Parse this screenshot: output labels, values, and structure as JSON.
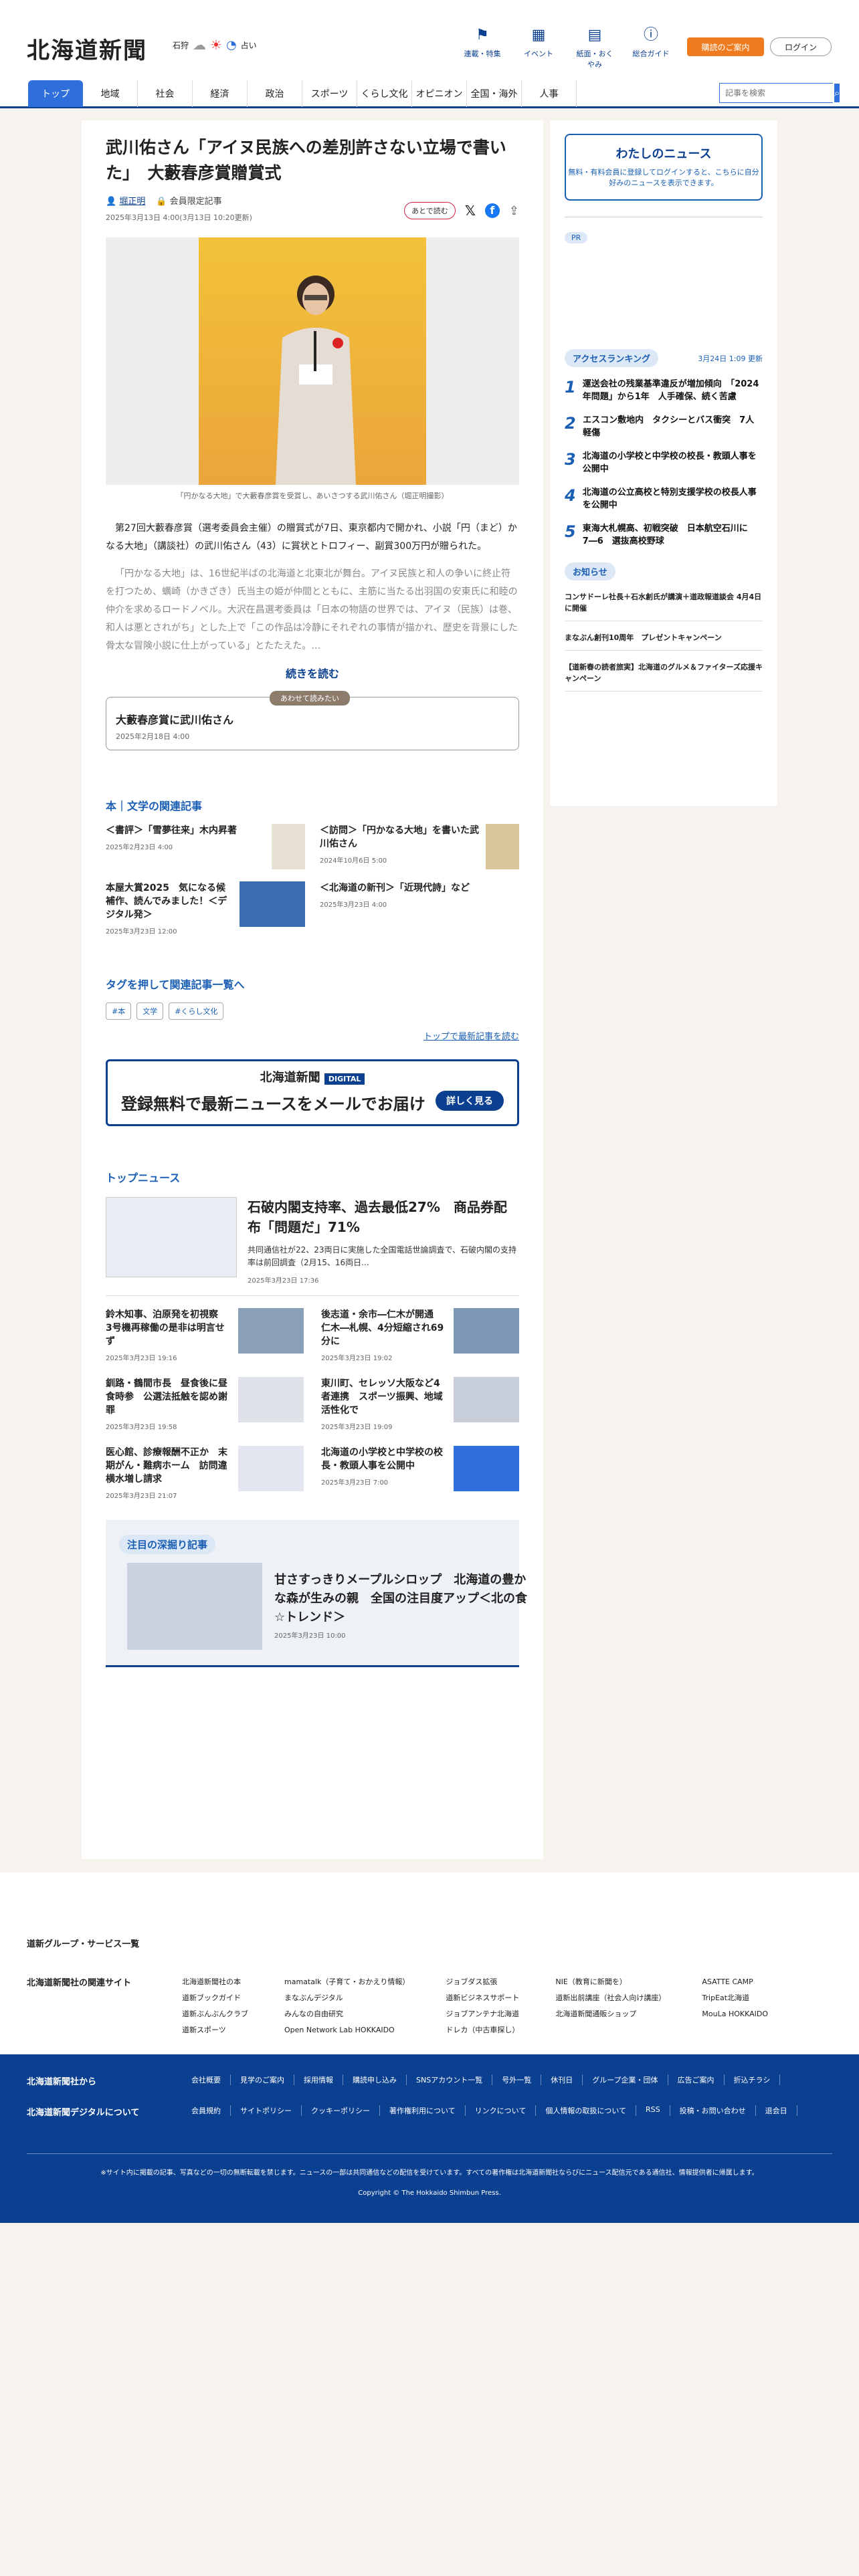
{
  "header": {
    "logo": "北海道新聞",
    "weather_place": "石狩",
    "weather_text": "占い",
    "icons": [
      {
        "icon": "flag-icon",
        "label": "連載・特集"
      },
      {
        "icon": "calendar-icon",
        "label": "イベント"
      },
      {
        "icon": "book-icon",
        "label": "紙面・おくやみ"
      },
      {
        "icon": "help-icon",
        "label": "総合ガイド"
      }
    ],
    "buy_label": "購読のご案内",
    "login_label": "ログイン"
  },
  "nav": {
    "items": [
      "トップ",
      "地域",
      "社会",
      "経済",
      "政治",
      "スポーツ",
      "くらし文化",
      "オピニオン",
      "全国・海外",
      "人事"
    ],
    "search_placeholder": "記事を検索"
  },
  "article": {
    "title": "武川佑さん「アイヌ民族への差別許さない立場で書いた」　大藪春彦賞贈賞式",
    "author": "堀正明",
    "member": "会員限定記事",
    "dates": "2025年3月13日 4:00(3月13日 10:20更新)",
    "later": "あとで読む",
    "caption": "「円かなる大地」で大藪春彦賞を受賞し、あいさつする武川佑さん（堀正明撮影）",
    "p1": "第27回大藪春彦賞（選考委員会主催）の贈賞式が7日、東京都内で開かれ、小説「円（まど）かなる大地」（講談社）の武川佑さん（43）に賞状とトロフィー、副賞300万円が贈られた。",
    "p2": "「円かなる大地」は、16世紀半ばの北海道と北東北が舞台。アイヌ民族と和人の争いに終止符を打つため、蠣崎（かきざき）氏当主の姫が仲間とともに、主筋に当たる出羽国の安東氏に和睦の仲介を求めるロードノベル。大沢在昌選考委員は「日本の物語の世界では、アイヌ（民族）は巻、和人は悪とされがち」とした上で「この作品は冷静にそれぞれの事情が描かれ、歴史を背景にした骨太な冒険小説に仕上がっている」とたたえた。…",
    "read_more": "続きを読む",
    "also_tag": "あわせて読みたい",
    "also_title": "大藪春彦賞に武川佑さん",
    "also_date": "2025年2月18日 4:00"
  },
  "related": {
    "heading": "本｜文学の関連記事",
    "items": [
      {
        "title": "＜書評＞「雪夢往来」木内昇著",
        "date": "2025年2月23日 4:00"
      },
      {
        "title": "＜訪問＞「円かなる大地」を書いた武川佑さん",
        "date": "2024年10月6日 5:00"
      },
      {
        "title": "本屋大賞2025　気になる候補作、読んでみました！＜デジタル発＞",
        "date": "2025年3月23日 12:00"
      },
      {
        "title": "＜北海道の新刊＞「近現代詩」など",
        "date": "2025年3月23日 4:00"
      }
    ]
  },
  "tags": {
    "heading": "タグを押して関連記事一覧へ",
    "items": [
      "#本",
      "文学",
      "#くらし文化"
    ],
    "toplink": "トップで最新記事を読む"
  },
  "banner": {
    "logo": "北海道新聞",
    "digital": "DIGITAL",
    "text": "登録無料で最新ニュースをメールでお届け",
    "button": "詳しく見る"
  },
  "topnews": {
    "heading": "トップニュース",
    "lead_title": "石破内閣支持率、過去最低27%　商品券配布「問題だ」71%",
    "lead_sum": "共同通信社が22、23両日に実施した全国電話世論調査で、石破内閣の支持率は前回調査（2月15、16両日...",
    "lead_date": "2025年3月23日 17:36",
    "items": [
      {
        "title": "鈴木知事、泊原発を初視察　3号機再稼働の是非は明言せず",
        "date": "2025年3月23日 19:16"
      },
      {
        "title": "後志道・余市―仁木が開通　仁木―札幌、4分短縮され69分に",
        "date": "2025年3月23日 19:02"
      },
      {
        "title": "釧路・鶴間市長　昼食後に昼食時参　公選法抵触を認め謝罪",
        "date": "2025年3月23日 19:58"
      },
      {
        "title": "東川町、セレッソ大阪など4者連携　スポーツ振興、地域活性化で",
        "date": "2025年3月23日 19:09"
      },
      {
        "title": "医心館、診療報酬不正か　末期がん・難病ホーム　訪問違横水増し請求",
        "date": "2025年3月23日 21:07"
      },
      {
        "title": "北海道の小学校と中学校の校長・教頭人事を公開中",
        "date": "2025年3月23日 7:00"
      }
    ]
  },
  "feature": {
    "heading": "注目の深掘り記事",
    "title": "甘さすっきりメープルシロップ　北海道の豊かな森が生みの親　全国の注目度アップ＜北の食☆トレンド＞",
    "date": "2025年3月23日 10:00"
  },
  "side": {
    "my_title": "わたしのニュース",
    "my_desc": "無料・有料会員に登録してログインすると、こちらに自分好みのニュースを表示できます。",
    "pr": "PR",
    "rank_heading": "アクセスランキング",
    "rank_updated": "3月24日 1:09 更新",
    "rank": [
      "運送会社の残業基準違反が増加傾向　「2024年問題」から1年　人手確保、続く苦慮",
      "エスコン敷地内　タクシーとバス衝突　7人軽傷",
      "北海道の小学校と中学校の校長・教頭人事を公開中",
      "北海道の公立高校と特別支援学校の校長人事を公開中",
      "東海大札幌高、初戦突破　日本航空石川に7―6　選抜高校野球"
    ],
    "notice_heading": "お知らせ",
    "notices": [
      "コンサドーレ社長＋石水創氏が講演＋道政報道談会 4月4日に開催",
      "まなぶん創刊10周年　プレゼントキャンペーン",
      "【道新春の読者旅実】北海道のグルメ＆ファイターズ応援キャンペーン"
    ]
  },
  "footer": {
    "group_heading": "道新グループ・サービス一覧",
    "related_heading": "北海道新聞社の関連サイト",
    "cols": [
      [
        "北海道新聞社の本",
        "道新ブックガイド",
        "道新ぶんぶんクラブ",
        "道新スポーツ"
      ],
      [
        "mamatalk（子育て・おかえり情報）",
        "まなぶんデジタル",
        "みんなの自由研究",
        "Open Network Lab HOKKAIDO"
      ],
      [
        "ジョブダス拡張",
        "道新ビジネスサポート",
        "ジョブアンテナ北海道",
        "ドレカ（中古車探し）"
      ],
      [
        "NIE（教育に新聞を）",
        "道新出前講座（社会人向け講座）",
        "北海道新聞通販ショップ"
      ],
      [
        "ASATTE CAMP",
        "TripEat北海道",
        "MouLa HOKKAIDO"
      ]
    ],
    "from_heading": "北海道新聞社から",
    "digital_heading": "北海道新聞デジタルについて",
    "row1": [
      "会社概要",
      "見学のご案内",
      "採用情報",
      "購読申し込み",
      "SNSアカウント一覧",
      "号外一覧",
      "休刊日",
      "グループ企業・団体",
      "広告ご案内",
      "折込チラシ"
    ],
    "row2": [
      "会員規約",
      "サイトポリシー",
      "クッキーポリシー",
      "著作権利用について",
      "リンクについて",
      "個人情報の取扱について",
      "RSS",
      "投稿・お問い合わせ",
      "退会日"
    ],
    "note": "※サイト内に掲載の記事、写真などの一切の無断転載を禁じます。ニュースの一部は共同通信などの配信を受けています。すべての著作権は北海道新聞社ならびにニュース配信元である通信社、情報提供者に帰属します。",
    "copy": "Copyright © The Hokkaido Shimbun Press."
  }
}
